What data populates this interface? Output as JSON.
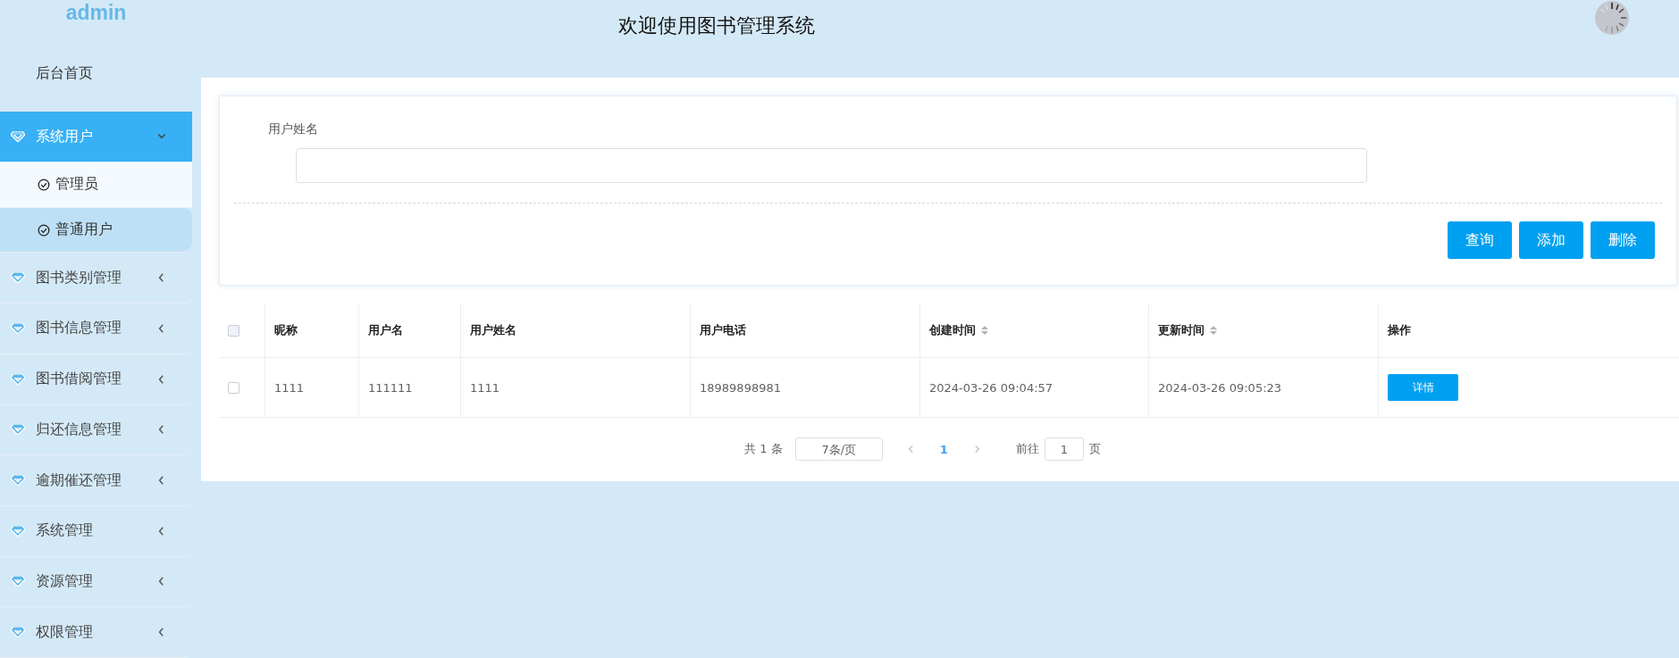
{
  "sidebar": {
    "logo": "admin",
    "items": [
      {
        "kind": "link",
        "label": "后台首页"
      },
      {
        "kind": "group",
        "label": "系统用户",
        "expanded": true,
        "children": [
          {
            "label": "管理员",
            "selected": false
          },
          {
            "label": "普通用户",
            "selected": true
          }
        ]
      },
      {
        "kind": "group",
        "label": "图书类别管理",
        "expanded": false
      },
      {
        "kind": "group",
        "label": "图书信息管理",
        "expanded": false
      },
      {
        "kind": "group",
        "label": "图书借阅管理",
        "expanded": false
      },
      {
        "kind": "group",
        "label": "归还信息管理",
        "expanded": false
      },
      {
        "kind": "group",
        "label": "逾期催还管理",
        "expanded": false
      },
      {
        "kind": "group",
        "label": "系统管理",
        "expanded": false
      },
      {
        "kind": "group",
        "label": "资源管理",
        "expanded": false
      },
      {
        "kind": "group",
        "label": "权限管理",
        "expanded": false
      }
    ]
  },
  "header": {
    "title": "欢迎使用图书管理系统"
  },
  "search": {
    "label": "用户姓名",
    "buttons": [
      "查询",
      "添加",
      "删除"
    ]
  },
  "table": {
    "select_all_checked": false,
    "columns": [
      {
        "label": "昵称",
        "sortable": false
      },
      {
        "label": "用户名",
        "sortable": false
      },
      {
        "label": "用户姓名",
        "sortable": false
      },
      {
        "label": "用户电话",
        "sortable": false
      },
      {
        "label": "创建时间",
        "sortable": true
      },
      {
        "label": "更新时间",
        "sortable": true
      },
      {
        "label": "操作",
        "sortable": false
      }
    ],
    "rows": [
      {
        "checked": false,
        "cells": [
          "1111",
          "111111",
          "1111",
          "18989898981",
          "2024-03-26 09:04:57",
          "2024-03-26 09:05:23"
        ],
        "action": "详情"
      }
    ]
  },
  "pagination": {
    "total": "共 1 条",
    "page_size": "7条/页",
    "pages": [
      {
        "label": "1",
        "selected": true
      }
    ],
    "goto_label": "前往",
    "goto_value": "1",
    "goto_suffix": "页"
  }
}
